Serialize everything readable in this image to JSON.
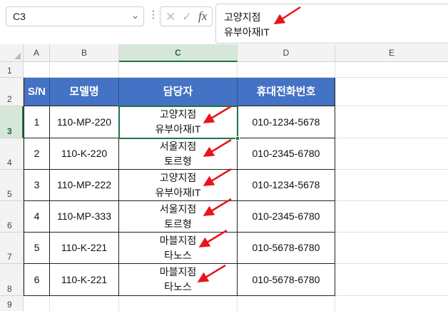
{
  "formula_bar": {
    "name_box": "C3",
    "content_lines": [
      "고양지점",
      "유부아재IT"
    ],
    "fx": "fx"
  },
  "columns": [
    "A",
    "B",
    "C",
    "D",
    "E"
  ],
  "rows": [
    "1",
    "2",
    "3",
    "4",
    "5",
    "6",
    "7",
    "8",
    "9"
  ],
  "table": {
    "headers": [
      "S/N",
      "모델명",
      "담당자",
      "휴대전화번호"
    ],
    "rows": [
      {
        "sn": "1",
        "model": "110-MP-220",
        "mgr1": "고양지점",
        "mgr2": "유부아재IT",
        "phone": "010-1234-5678"
      },
      {
        "sn": "2",
        "model": "110-K-220",
        "mgr1": "서울지점",
        "mgr2": "토르형",
        "phone": "010-2345-6780"
      },
      {
        "sn": "3",
        "model": "110-MP-222",
        "mgr1": "고양지점",
        "mgr2": "유부아재IT",
        "phone": "010-1234-5678"
      },
      {
        "sn": "4",
        "model": "110-MP-333",
        "mgr1": "서울지점",
        "mgr2": "토르형",
        "phone": "010-2345-6780"
      },
      {
        "sn": "5",
        "model": "110-K-221",
        "mgr1": "마블지점",
        "mgr2": "타노스",
        "phone": "010-5678-6780"
      },
      {
        "sn": "6",
        "model": "110-K-221",
        "mgr1": "마블지점",
        "mgr2": "타노스",
        "phone": "010-5678-6780"
      }
    ]
  },
  "colors": {
    "header_fill": "#4472c4",
    "selection": "#217346",
    "arrow": "#e8141c"
  }
}
